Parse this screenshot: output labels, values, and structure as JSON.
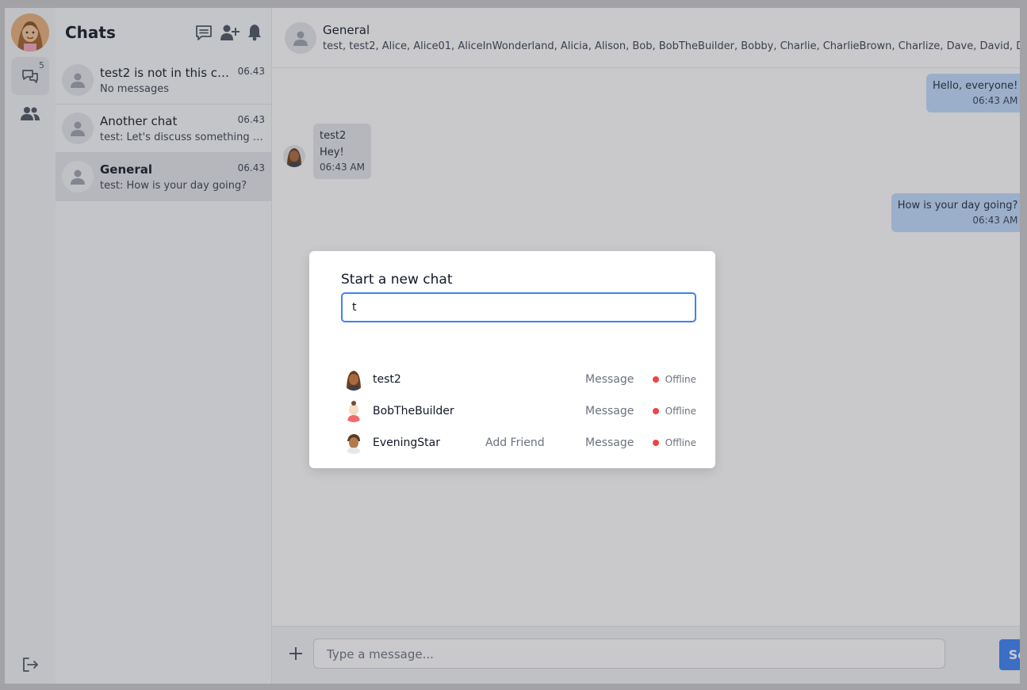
{
  "rail": {
    "chats_badge": "5"
  },
  "list": {
    "title": "Chats",
    "items": [
      {
        "name": "test2 is not in this chat",
        "preview": "No messages",
        "time": "06.43"
      },
      {
        "name": "Another chat",
        "preview": "test: Let's discuss something in this chat",
        "time": "06.43"
      },
      {
        "name": "General",
        "preview": "test: How is your day going?",
        "time": "06.43"
      }
    ]
  },
  "chat": {
    "name": "General",
    "members": "test, test2, Alice, Alice01, AliceInWonderland, Alicia, Alison, Bob, BobTheBuilder, Bobby, Charlie, CharlieBrown, Charlize, Dave, David, Dave...",
    "messages": [
      {
        "text": "Hello, everyone!",
        "time": "06:43 AM"
      },
      {
        "from": "test2",
        "text": "Hey!",
        "time": "06:43 AM"
      },
      {
        "text": "How is your day going?",
        "time": "06:43 AM"
      }
    ]
  },
  "composer": {
    "placeholder": "Type a message...",
    "send_label": "Send"
  },
  "modal": {
    "title": "Start a new chat",
    "search_value": "t",
    "results": [
      {
        "name": "test2",
        "add_friend": "",
        "message": "Message",
        "status": "Offline"
      },
      {
        "name": "BobTheBuilder",
        "add_friend": "",
        "message": "Message",
        "status": "Offline"
      },
      {
        "name": "EveningStar",
        "add_friend": "Add Friend",
        "message": "Message",
        "status": "Offline"
      }
    ]
  },
  "colors": {
    "accent": "#3b82f6",
    "offline": "#ef4444",
    "outgoing_bubble": "#bfdbfe"
  }
}
